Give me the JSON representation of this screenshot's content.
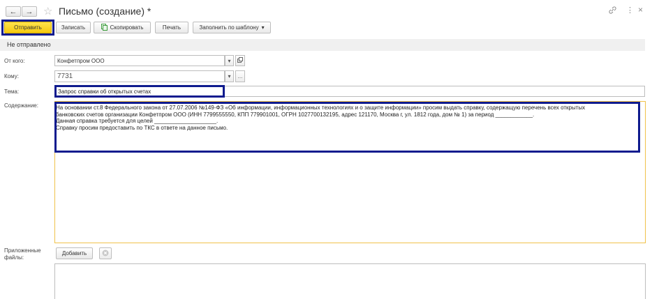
{
  "window": {
    "title": "Письмо (создание) *"
  },
  "nav": {
    "back": "←",
    "forward": "→"
  },
  "icons": {
    "star": "☆",
    "link": "🔗",
    "more": "⋮",
    "close": "×"
  },
  "toolbar": {
    "send_label": "Отправить",
    "save_label": "Записать",
    "copy_label": "Скопировать",
    "print_label": "Печать",
    "template_label": "Заполнить по шаблону",
    "dropdown_arrow": "▾"
  },
  "status": "Не отправлено",
  "form": {
    "from_label": "От кого:",
    "from_value": "Конфетпром ООО",
    "to_label": "Кому:",
    "to_value": "7731",
    "subject_label": "Тема:",
    "subject_value": "Запрос справки об открытых счетах",
    "content_label": "Содержание:",
    "content_lines": [
      "На основании ст.8 Федерального закона от 27.07.2006 №149-ФЗ «Об информации, информационных технологиях и о защите информации» просим выдать справку, содержащую перечень всех открытых",
      "банковских счетов организации Конфетпром ООО (ИНН 7799555550, КПП 779901001, ОГРН 1027700132195, адрес 121170, Москва г, ул. 1812 года, дом № 1) за период ____________.",
      "Данная справка требуется для целей ____________________.",
      "Справку просим предоставить по ТКС в ответе на данное письмо."
    ],
    "attachments_label_1": "Приложенные",
    "attachments_label_2": "файлы:",
    "add_label": "Добавить",
    "ellipsis": "...",
    "dropdown_arrow": "▾"
  },
  "colors": {
    "accent_yellow": "#f6c90e",
    "highlight_blue": "#0f1b8e",
    "content_border": "#f0c24a"
  }
}
